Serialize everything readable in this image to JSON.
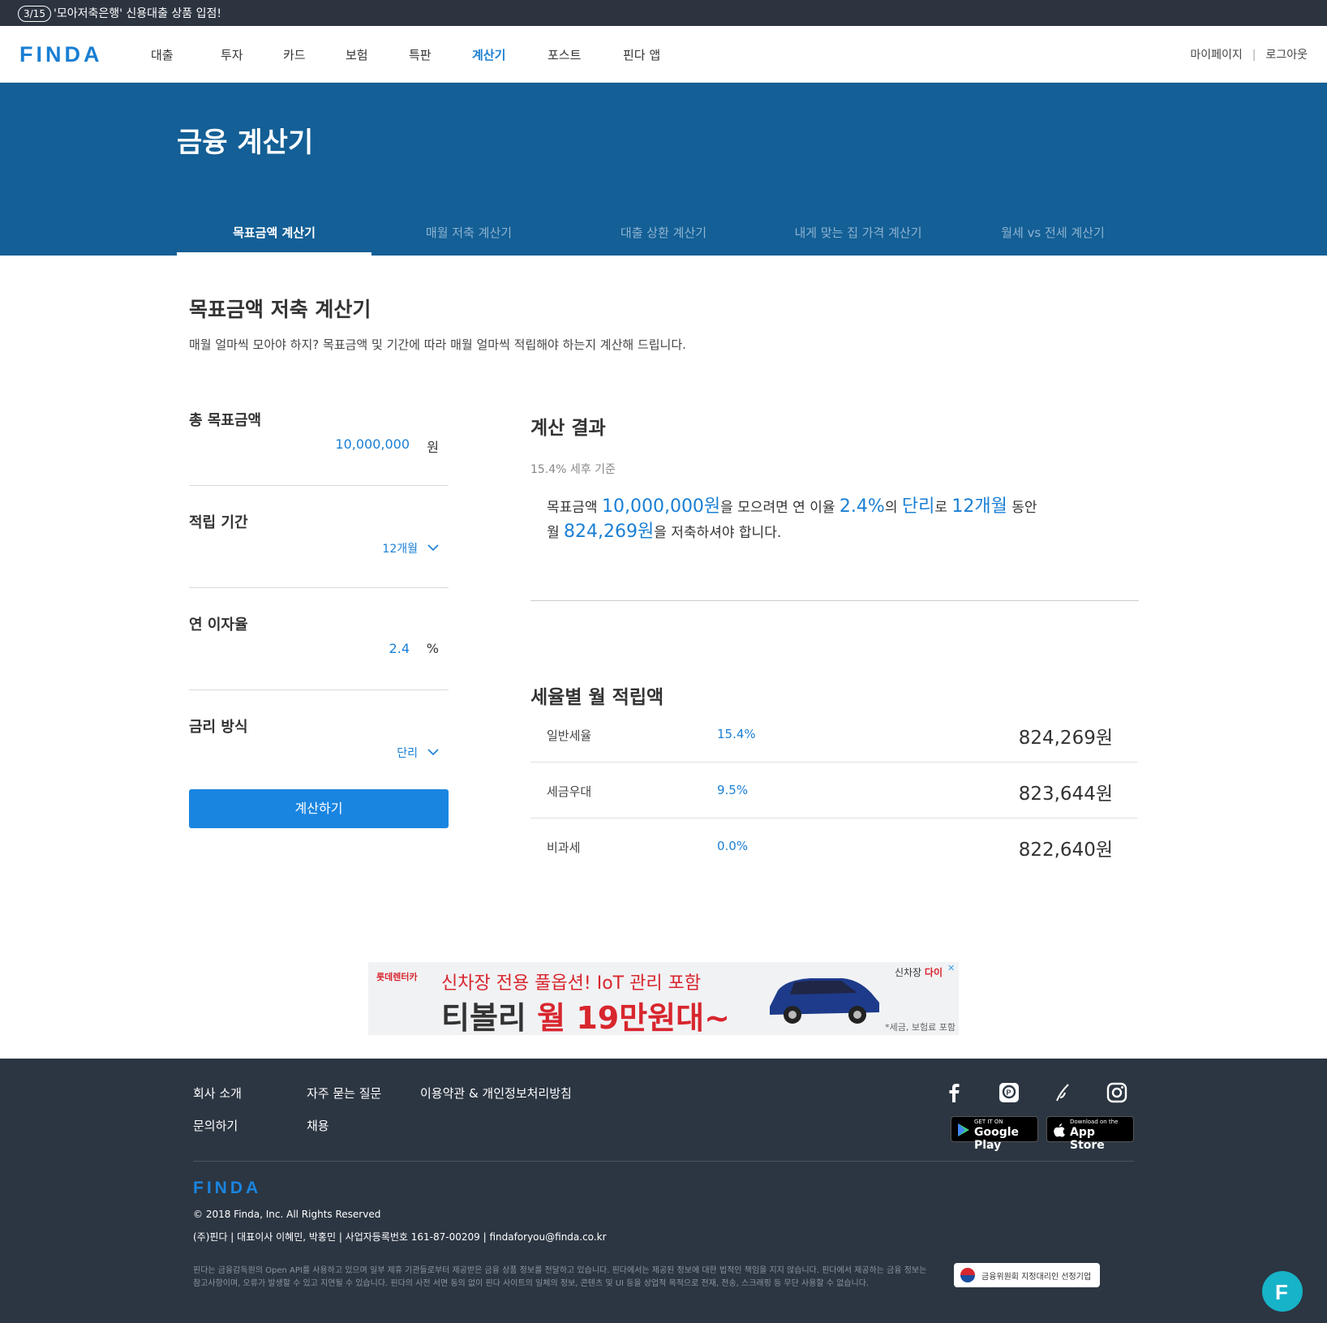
{
  "notice": {
    "date": "3/15",
    "text": "'모아저축은행' 신용대출 상품 입점!"
  },
  "header": {
    "logo": "FINDA",
    "nav": [
      "대출",
      "투자",
      "카드",
      "보험",
      "특판",
      "계산기",
      "포스트",
      "핀다 앱"
    ],
    "active_nav": "계산기",
    "mypage": "마이페이지",
    "logout": "로그아웃"
  },
  "hero": {
    "title": "금융 계산기",
    "tabs": [
      "목표금액 계산기",
      "매월 저축 계산기",
      "대출 상환 계산기",
      "내게 맞는 집 가격 계산기",
      "월세 vs 전세 계산기"
    ],
    "active_tab": "목표금액 계산기"
  },
  "calculator": {
    "title": "목표금액 저축 계산기",
    "description": "매월 얼마씩 모아야 하지?  목표금액 및 기간에 따라 매월 얼마씩 적립해야 하는지 계산해 드립니다.",
    "fields": {
      "target_amount": {
        "label": "총 목표금액",
        "value": "10,000,000",
        "unit": "원"
      },
      "period": {
        "label": "적립 기간",
        "value": "12개월"
      },
      "rate": {
        "label": "연 이자율",
        "value": "2.4",
        "unit": "%"
      },
      "method": {
        "label": "금리 방식",
        "value": "단리"
      }
    },
    "button": "계산하기"
  },
  "result": {
    "title": "계산 결과",
    "subtitle": "15.4% 세후 기준",
    "sentence": {
      "p1": "목표금액 ",
      "amount": "10,000,000원",
      "p2": "을 모으려면 연 이율 ",
      "rate": "2.4%",
      "p3": "의 ",
      "method": "단리",
      "p4": "로 ",
      "period": "12개월",
      "p5": " 동안",
      "p6": "월 ",
      "monthly": "824,269원",
      "p7": "을 저축하셔야 합니다."
    }
  },
  "tax_table": {
    "title": "세율별 월 적립액",
    "rows": [
      {
        "name": "일반세율",
        "rate": "15.4%",
        "amount": "824,269원"
      },
      {
        "name": "세금우대",
        "rate": "9.5%",
        "amount": "823,644원"
      },
      {
        "name": "비과세",
        "rate": "0.0%",
        "amount": "822,640원"
      }
    ]
  },
  "ad": {
    "brand": "롯데렌터카",
    "line1": "신차장 전용 풀옵션! IoT 관리 포함",
    "line2_a": "티볼리 ",
    "line2_b": "월 19만원대~",
    "tag_a": "신차장 ",
    "tag_b": "다이",
    "note": "*세금, 보험료 포함"
  },
  "footer": {
    "links": [
      "회사 소개",
      "자주 묻는 질문",
      "이용약관 & 개인정보처리방침",
      "문의하기",
      "채용"
    ],
    "social_icons": [
      "facebook-icon",
      "post-icon",
      "brunch-icon",
      "instagram-icon"
    ],
    "google_play": {
      "small": "GET IT ON",
      "big": "Google Play"
    },
    "app_store": {
      "small": "Download on the",
      "big": "App Store"
    },
    "logo": "FINDA",
    "copyright": "© 2018 Finda, Inc. All Rights Reserved",
    "company": "(주)핀다 | 대표이사 이혜민, 박홍민 | 사업자등록번호 161-87-00209 | findaforyou@finda.co.kr",
    "disclaimer": "핀다는 금융감독원의 Open API를 사용하고 있으며 일부 제휴 기관들로부터 제공받은 금융 상품 정보를 전달하고 있습니다. 핀다에서는 제공된 정보에 대한 법적인 책임을 지지 않습니다. 핀다에서 제공하는 금융 정보는 참고사항이며, 오류가 발생할 수 있고 지연될 수 있습니다. 핀다의 사전 서면 동의 없이 핀다 사이트의 일체의 정보, 콘텐츠 및 UI 등을 상업적 목적으로 전재, 전송, 스크래핑 등 무단 사용할 수 없습니다.",
    "badge": "금융위원회 지정대리인 선정기업"
  },
  "colors": {
    "accent": "#1a7fd4",
    "hero_bg": "#135f96",
    "footer_bg": "#2c3642",
    "chat_button": "#17b3c8"
  }
}
